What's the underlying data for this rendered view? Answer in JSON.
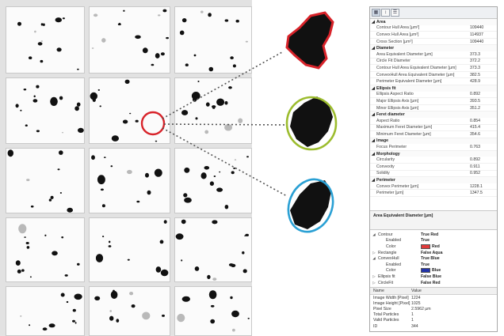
{
  "toolbar": {
    "buttons": [
      {
        "icon": "categorized-icon",
        "glyph": "▦"
      },
      {
        "icon": "sort-az-icon",
        "glyph": "↕"
      },
      {
        "icon": "property-pages-icon",
        "glyph": "☰"
      }
    ]
  },
  "properties": [
    {
      "category": "Area",
      "rows": [
        {
          "name": "Contour Hull Area [µm²]",
          "value": "109440"
        },
        {
          "name": "Convex Hull Area [µm²]",
          "value": "114937"
        },
        {
          "name": "Cross Section [µm²]",
          "value": "109440"
        }
      ]
    },
    {
      "category": "Diameter",
      "rows": [
        {
          "name": "Area Equivalent Diameter [µm]",
          "value": "373.3"
        },
        {
          "name": "Circle Fit Diameter",
          "value": "372.2"
        },
        {
          "name": "Contour Hull Area Equivalent Diameter [µm]",
          "value": "373.3"
        },
        {
          "name": "ConvexHull Area Equivalent Diameter [µm]",
          "value": "382.5"
        },
        {
          "name": "Perimeter Equivalent Diameter [µm]",
          "value": "428.9"
        }
      ]
    },
    {
      "category": "Ellipsis fit",
      "rows": [
        {
          "name": "Ellipsis Aspect Ratio",
          "value": "0.892"
        },
        {
          "name": "Major Ellipsis Axis [µm]",
          "value": "393.5"
        },
        {
          "name": "Minor Ellipsis Axis [µm]",
          "value": "351.2"
        }
      ]
    },
    {
      "category": "Feret diameter",
      "rows": [
        {
          "name": "Aspect Ratio",
          "value": "0.854"
        },
        {
          "name": "Maximum Feret Diameter [µm]",
          "value": "415.4"
        },
        {
          "name": "Minimum Feret Diameter [µm]",
          "value": "354.6"
        }
      ]
    },
    {
      "category": "Image",
      "rows": [
        {
          "name": "Focus Perimeter",
          "value": "0.763"
        }
      ]
    },
    {
      "category": "Morphology",
      "rows": [
        {
          "name": "Circularity",
          "value": "0.892"
        },
        {
          "name": "Convexity",
          "value": "0.911"
        },
        {
          "name": "Solidity",
          "value": "0.952"
        }
      ]
    },
    {
      "category": "Perimeter",
      "rows": [
        {
          "name": "Convex Perimeter [µm]",
          "value": "1228.1"
        },
        {
          "name": "Perimeter [µm]",
          "value": "1347.5"
        }
      ]
    }
  ],
  "description": {
    "title": "Area Equivalent Diameter [µm]"
  },
  "visualization": [
    {
      "name": "Contour",
      "value": "True Red",
      "expander": "◢",
      "child": false
    },
    {
      "name": "Enabled",
      "value": "True",
      "expander": "",
      "child": true
    },
    {
      "name": "Color",
      "value": "Red",
      "expander": "",
      "child": true,
      "swatch": "#e03a3a"
    },
    {
      "name": "Rectangle",
      "value": "False Aqua",
      "expander": "▷",
      "child": false
    },
    {
      "name": "ConvexHull",
      "value": "True Blue",
      "expander": "◢",
      "child": false
    },
    {
      "name": "Enabled",
      "value": "True",
      "expander": "",
      "child": true
    },
    {
      "name": "Color",
      "value": "Blue",
      "expander": "",
      "child": true,
      "swatch": "#2233aa"
    },
    {
      "name": "Ellipsis fit",
      "value": "False Blue",
      "expander": "▷",
      "child": false
    },
    {
      "name": "CircleFit",
      "value": "False Red",
      "expander": "▷",
      "child": false
    }
  ],
  "info": {
    "header": {
      "name": "Name",
      "value": "Value"
    },
    "rows": [
      {
        "name": "Image Width [Pixel]",
        "value": "1224"
      },
      {
        "name": "Image Height [Pixel]",
        "value": "1025"
      },
      {
        "name": "Pixel Size",
        "value": "2.5962 µm"
      },
      {
        "name": "Total Particles",
        "value": "1"
      },
      {
        "name": "Valid Particles",
        "value": "1"
      },
      {
        "name": "ID",
        "value": "344"
      }
    ]
  },
  "colors": {
    "contour": "#d8232a",
    "ellipse": "#9cbc2e",
    "convex_hull": "#2aa0d4",
    "connector": "#555555",
    "particle": "#111111"
  }
}
